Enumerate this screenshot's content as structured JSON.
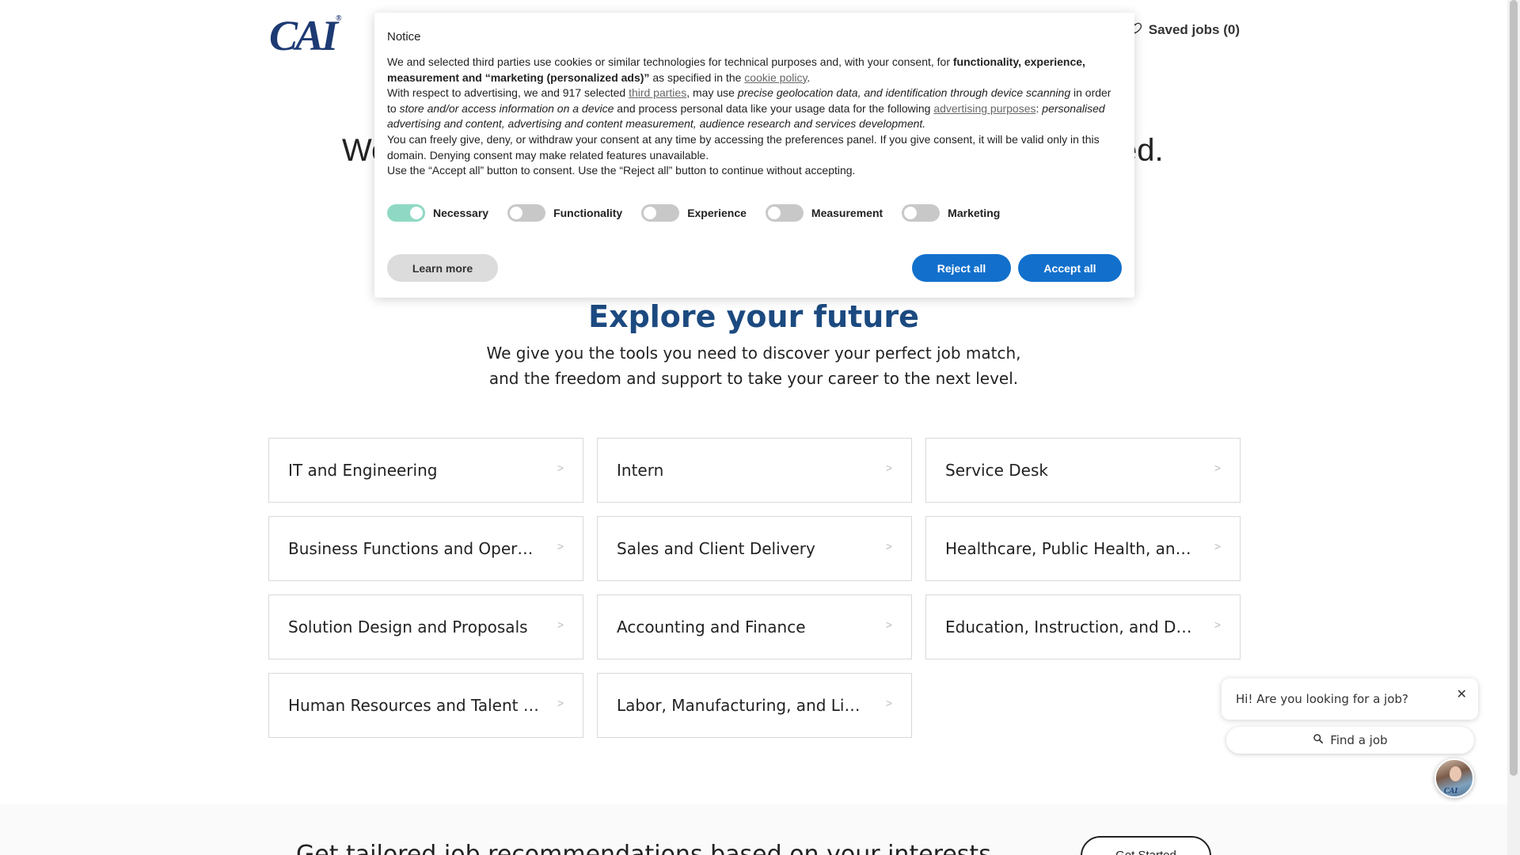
{
  "header": {
    "logo_text": "CAI",
    "logo_mark": "®",
    "saved_jobs": "Saved jobs (0)",
    "saved_icon": "heart-icon"
  },
  "hero": {
    "left_fragment": "We",
    "right_fragment": "ed."
  },
  "explore": {
    "title": "Explore your future",
    "line1": "We give you the tools you need to discover your perfect job match,",
    "line2": "and the freedom and support to take your career to the next level."
  },
  "categories": [
    "IT and Engineering",
    "Intern",
    "Service Desk",
    "Business Functions and Operati...",
    "Sales and Client Delivery",
    "Healthcare, Public Health, and S...",
    "Solution Design and Proposals",
    "Accounting and Finance",
    "Education, Instruction, and Deve...",
    "Human Resources and Talent Ac...",
    "Labor, Manufacturing, and Light..."
  ],
  "tailored": {
    "text": "Get tailored job recommendations based on your interests",
    "button": "Get Started"
  },
  "consent": {
    "title": "Notice",
    "p1_a": "We and selected third parties use cookies or similar technologies for technical purposes and, with your consent, for ",
    "p1_b": "functionality, experience, measurement and “marketing (personalized ads)”",
    "p1_c": " as specified in the ",
    "p1_link": "cookie policy",
    "p1_d": ".",
    "p2_a": "With respect to advertising, we and 917 selected ",
    "p2_link1": "third parties",
    "p2_b": ", may use ",
    "p2_c": "precise geolocation data, and identification through device scanning",
    "p2_d": " in order to ",
    "p2_e": "store and/or access information on a device",
    "p2_f": " and process personal data like your usage data for the following ",
    "p2_link2": "advertising purposes",
    "p2_g": ": ",
    "p2_h": "personalised advertising and content, advertising and content measurement, audience research and services development.",
    "p3": "You can freely give, deny, or withdraw your consent at any time by accessing the preferences panel. If you give consent, it will be valid only in this domain. Denying consent may make related features unavailable.",
    "p4": "Use the “Accept all” button to consent. Use the “Reject all” button to continue without accepting.",
    "toggles": [
      {
        "label": "Necessary",
        "on": true
      },
      {
        "label": "Functionality",
        "on": false
      },
      {
        "label": "Experience",
        "on": false
      },
      {
        "label": "Measurement",
        "on": false
      },
      {
        "label": "Marketing",
        "on": false
      }
    ],
    "learn_more": "Learn more",
    "reject_all": "Reject all",
    "accept_all": "Accept all",
    "accent_color": "#1270cc",
    "toggle_on_color": "#8fd9c4"
  },
  "chat": {
    "greeting": "Hi! Are you looking for a job?",
    "close": "✕",
    "find_job": "Find a job",
    "find_icon": "search-icon",
    "avatar_mark": "CAI"
  }
}
